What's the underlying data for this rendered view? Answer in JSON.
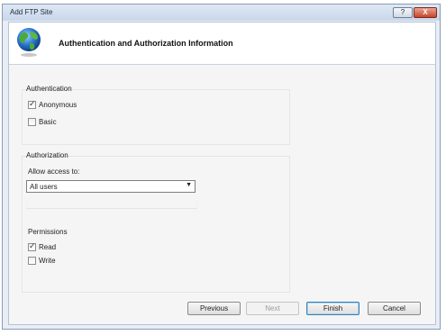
{
  "window": {
    "title": "Add FTP Site",
    "help_label": "?",
    "close_label": "X"
  },
  "header": {
    "title": "Authentication and Authorization Information",
    "icon": "globe-icon"
  },
  "authentication": {
    "label": "Authentication",
    "anonymous": {
      "label": "Anonymous",
      "checked": true
    },
    "basic": {
      "label": "Basic",
      "checked": false
    }
  },
  "authorization": {
    "label": "Authorization",
    "allow_access_label": "Allow access to:",
    "allow_access_value": "All users",
    "permissions_label": "Permissions",
    "read": {
      "label": "Read",
      "checked": true
    },
    "write": {
      "label": "Write",
      "checked": false
    }
  },
  "buttons": {
    "previous": "Previous",
    "next": "Next",
    "finish": "Finish",
    "cancel": "Cancel"
  }
}
